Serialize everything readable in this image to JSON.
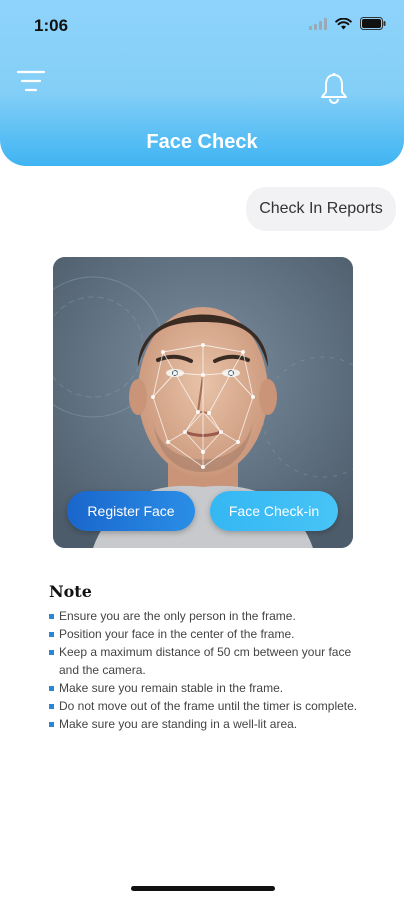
{
  "status_bar": {
    "time": "1:06"
  },
  "header": {
    "title": "Face Check"
  },
  "actions": {
    "reports_label": "Check In Reports"
  },
  "camera": {
    "register_label": "Register Face",
    "checkin_label": "Face Check-in"
  },
  "note": {
    "title": "Note",
    "items": [
      "Ensure you are the only person in the frame.",
      "Position your face in the center of the frame.",
      "Keep a maximum distance of 50 cm between your face and the camera.",
      "Make sure you remain stable in the frame.",
      "Do not move out of the frame until the timer is complete.",
      "Make sure you are standing in a well-lit area."
    ]
  },
  "colors": {
    "header_top": "#8ed3fb",
    "header_bottom": "#3fb4f2",
    "register_button": "#1a66cc",
    "checkin_button": "#3bbaf4",
    "bullet": "#2a86d6"
  },
  "icons": {
    "menu": "menu-icon",
    "bell": "bell-icon",
    "signal": "signal-icon",
    "wifi": "wifi-icon",
    "battery": "battery-icon"
  }
}
